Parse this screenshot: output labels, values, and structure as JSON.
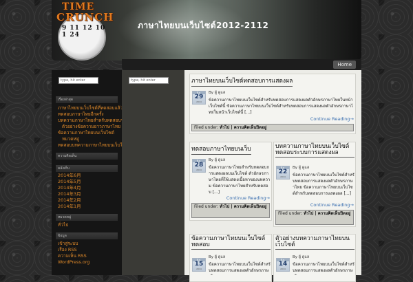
{
  "site": {
    "title": "ภาษาไทยบนเว็บไซต์2012-2112",
    "logo_word1": "TIME",
    "logo_word2": "CRUNCH",
    "logo_numbers": "9 11 12 10 1 24"
  },
  "nav": {
    "home": "Home"
  },
  "search": {
    "placeholder": "type, hit enter"
  },
  "sidebar": {
    "recent_title": "เรื่องล่าสุด",
    "recent_posts": [
      "ภาษาไทยบนเว็บไซต์ที่ทดสอบแล้ว",
      "ทดสอบภาษาไทยอีกครั้ง",
      "บทความภาษาไทยสำหรับทดสอบระบบ",
      "ตัวอย่างข้อความยาวภาษาไทย",
      "ข้อความภาษาไทยบนเว็บไซต์",
      "หมวดหมู่",
      "ทดสอบบทความภาษาไทยบนเว็บไซต์"
    ],
    "comments_title": "ความคิดเห็น",
    "archives_title": "คลังเก็บ",
    "archives": [
      "2014年6月",
      "2014年5月",
      "2014年4月",
      "2014年3月",
      "2014年2月",
      "2014年1月"
    ],
    "categories_title": "หมวดหมู่",
    "categories": [
      "ทั่วไป"
    ],
    "meta_title": "ข้อมูล",
    "meta": [
      "เข้าสู่ระบบ",
      "เรื่อง RSS",
      "ความเห็น RSS",
      "WordPress.org"
    ]
  },
  "posts": [
    {
      "title": "ภาษาไทยบนเว็บไซต์ทดสอบการแสดงผล",
      "month": "มิ.ย.",
      "day": "29",
      "year": "2014",
      "byline": "By ผู้ ดูแล",
      "excerpt": "ข้อความภาษาไทยบนเว็บไซต์สำหรับทดสอบการแสดงผลตัวอักษรภาษาไทยในหน้าเว็บไซต์นี้ ข้อความภาษาไทยบนเว็บไซต์สำหรับทดสอบการแสดงผลตัวอักษรภาษาไทยในหน้าเว็บไซต์นี้ [...]",
      "more": "Continue Reading→",
      "filed_label": "Filed under:",
      "filed_value": "ทั่วไป | ความคิดเห็นปิดอยู่"
    },
    {
      "title": "ทดสอบภาษาไทยบนเว็บ",
      "month": "มิ.ย.",
      "day": "28",
      "year": "2014",
      "byline": "By ผู้ ดูแล",
      "excerpt": "ข้อความภาษาไทยสำหรับทดสอบการแสดงผลบนเว็บไซต์ ตัวอักษรภาษาไทยที่ใช้แสดงเนื้อหาของบทความ ข้อความภาษาไทยสำหรับทดสอบ [...]",
      "more": "Continue Reading→",
      "filed_label": "Filed under:",
      "filed_value": "ทั่วไป | ความคิดเห็นปิดอยู่"
    },
    {
      "title": "บทความภาษาไทยบนเว็บไซต์ทดสอบระบบการแสดงผล",
      "month": "มิ.ย.",
      "day": "22",
      "year": "2014",
      "byline": "By ผู้ ดูแล",
      "excerpt": "ข้อความภาษาไทยบนเว็บไซต์สำหรับทดสอบการแสดงผลตัวอักษรภาษาไทย ข้อความภาษาไทยบนเว็บไซต์สำหรับทดสอบการแสดงผล [...]",
      "more": "Continue Reading→",
      "filed_label": "Filed under:",
      "filed_value": "ทั่วไป | ความคิดเห็นปิดอยู่"
    },
    {
      "title": "ข้อความภาษาไทยบนเว็บไซต์ทดสอบ",
      "month": "มิ.ย.",
      "day": "15",
      "year": "2014",
      "byline": "By ผู้ ดูแล",
      "excerpt": "ข้อความภาษาไทยบนเว็บไซต์สำหรับทดสอบการแสดงผลตัวอักษรภาษาไทย"
    },
    {
      "title": "ตัวอย่างบทความภาษาไทยบนเว็บไซต์",
      "month": "มิ.ย.",
      "day": "14",
      "year": "2014",
      "byline": "By ผู้ ดูแล",
      "excerpt": "ข้อความภาษาไทยบนเว็บไซต์สำหรับทดสอบการแสดงผลตัวอักษรภาษาไทย"
    }
  ]
}
